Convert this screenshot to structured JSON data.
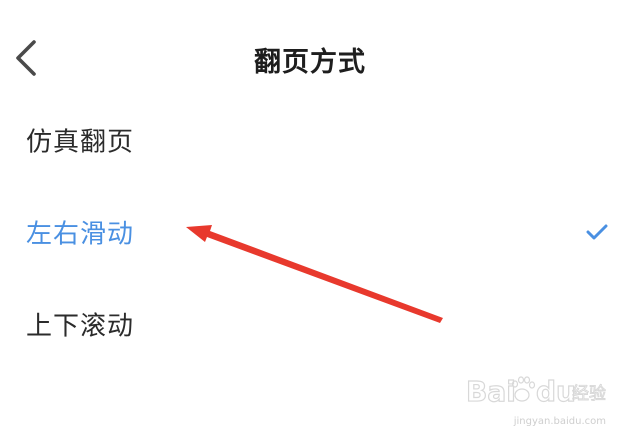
{
  "header": {
    "title": "翻页方式",
    "back_icon": "chevron-left-icon"
  },
  "options": [
    {
      "label": "仿真翻页",
      "selected": false
    },
    {
      "label": "左右滑动",
      "selected": true
    },
    {
      "label": "上下滚动",
      "selected": false
    }
  ],
  "check_icon": "checkmark-icon",
  "colors": {
    "accent": "#4a90e2",
    "text": "#2b2b2b",
    "title": "#1e1e1e",
    "annotation_arrow": "#e8392d"
  },
  "watermark": {
    "brand": "Baidu经验",
    "url": "jingyan.baidu.com"
  }
}
